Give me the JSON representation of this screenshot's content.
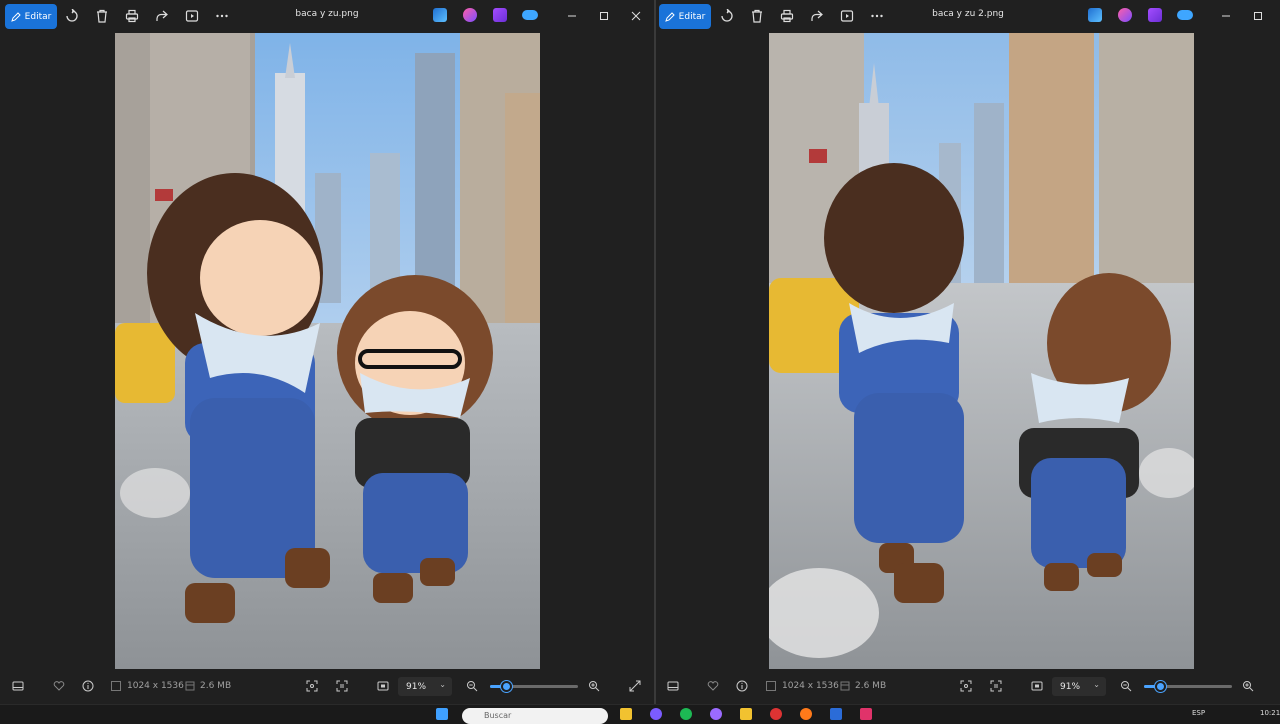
{
  "left_window": {
    "title": "baca y zu.png",
    "edit_label": "Editar",
    "dimensions": "1024 x 1536",
    "file_size": "2.6 MB",
    "zoom": "91%",
    "zoom_fraction": 0.18
  },
  "right_window": {
    "title": "baca y zu 2.png",
    "edit_label": "Editar",
    "dimensions": "1024 x 1536",
    "file_size": "2.6 MB",
    "zoom": "91%",
    "zoom_fraction": 0.18
  },
  "taskbar": {
    "search_placeholder": "Buscar",
    "language": "ESP",
    "time": "10:21"
  },
  "colors": {
    "accent": "#1a73d9",
    "window_bg": "#202020",
    "slider": "#4aa3ff"
  },
  "icons": [
    "edit-icon",
    "rotate-icon",
    "trash-icon",
    "print-icon",
    "share-icon",
    "slideshow-icon",
    "more-icon",
    "minimize-icon",
    "maximize-icon",
    "close-icon",
    "filmstrip-icon",
    "heart-icon",
    "info-icon",
    "dimensions-icon",
    "file-size-icon",
    "visual-search-icon",
    "text-scan-icon",
    "fit-icon",
    "zoom-out-icon",
    "zoom-in-icon",
    "expand-icon"
  ]
}
